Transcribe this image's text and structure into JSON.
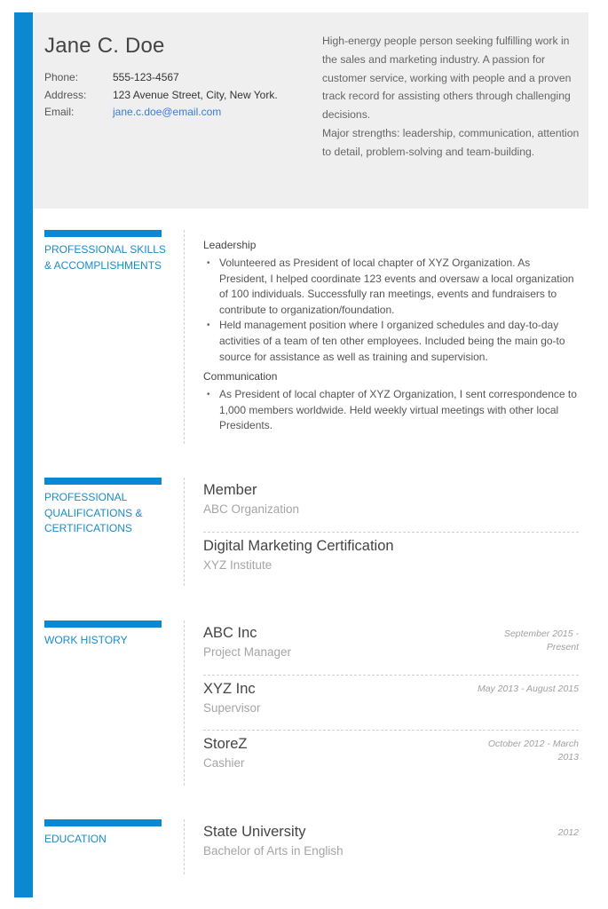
{
  "colors": {
    "accent": "#0a88d2",
    "section_title": "#1b8bc6",
    "link": "#3a7bd5",
    "header_bg": "#efefef"
  },
  "header": {
    "name": "Jane C. Doe",
    "contact": [
      {
        "label": "Phone:",
        "value": "555-123-4567"
      },
      {
        "label": "Address:",
        "value": "123 Avenue Street, City, New York."
      },
      {
        "label": "Email:",
        "value": "jane.c.doe@email.com"
      }
    ],
    "summary": [
      "High-energy people person seeking fulfilling work in the sales and marketing industry. A passion for customer service, working with people and a proven track record for assisting others through challenging decisions.",
      "Major strengths: leadership, communication, attention to detail, problem-solving and team-building."
    ]
  },
  "sections": {
    "skills": {
      "title": "PROFESSIONAL SKILLS & ACCOMPLISHMENTS",
      "groups": [
        {
          "heading": "Leadership",
          "items": [
            "Volunteered as President of local chapter of XYZ Organization. As President, I helped coordinate 123 events and oversaw a local organization of 100 individuals. Successfully ran meetings, events and fundraisers to contribute to organization/foundation.",
            "Held management position where I organized schedules and day-to-day activities of a team of ten other employees. Included being the main go-to source for assistance as well as training and supervision."
          ]
        },
        {
          "heading": "Communication",
          "items": [
            "As President of local chapter of XYZ Organization, I sent correspondence to 1,000 members worldwide. Held weekly virtual meetings with other local Presidents."
          ]
        }
      ]
    },
    "qualifications": {
      "title": "PROFESSIONAL QUALIFICATIONS & CERTIFICATIONS",
      "entries": [
        {
          "title": "Member",
          "sub": "ABC Organization"
        },
        {
          "title": "Digital Marketing Certification",
          "sub": "XYZ Institute"
        }
      ]
    },
    "work": {
      "title": "WORK HISTORY",
      "entries": [
        {
          "title": "ABC Inc",
          "sub": "Project Manager",
          "date": "September 2015 - Present"
        },
        {
          "title": "XYZ Inc",
          "sub": "Supervisor",
          "date": "May 2013 - August 2015"
        },
        {
          "title": "StoreZ",
          "sub": "Cashier",
          "date": "October 2012 - March 2013"
        }
      ]
    },
    "education": {
      "title": "EDUCATION",
      "entries": [
        {
          "title": "State University",
          "sub": "Bachelor of Arts in English",
          "date": "2012"
        }
      ]
    }
  }
}
